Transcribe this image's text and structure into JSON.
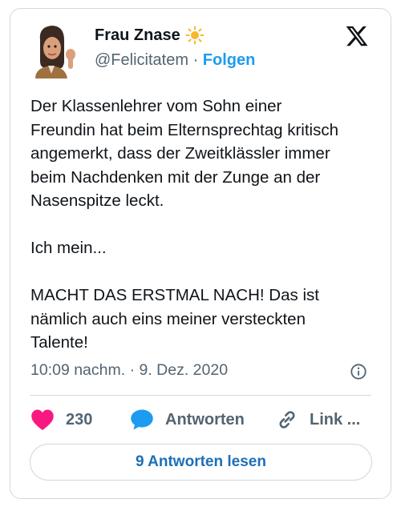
{
  "author": {
    "name": "Frau Znase",
    "name_emoji_icon": "sun-icon",
    "handle": "@Felicitatem",
    "separator": "·",
    "follow_label": "Folgen"
  },
  "platform_logo": "x-logo-icon",
  "tweet": {
    "paragraph1_lines": [
      "Der Klassenlehrer vom Sohn einer",
      "Freundin hat beim Elternsprechtag kritisch",
      "angemerkt, dass der Zweitklässler immer",
      "beim Nachdenken mit der Zunge an der",
      "Nasenspitze leckt."
    ],
    "paragraph2": "Ich mein...",
    "paragraph3_lines": [
      "MACHT DAS ERSTMAL NACH! Das ist",
      "nämlich auch eins meiner versteckten",
      "Talente!"
    ]
  },
  "timestamp": "10:09 nachm. · 9. Dez. 2020",
  "actions": {
    "likes_count": "230",
    "reply_label": "Antworten",
    "link_label": "Link ..."
  },
  "read_replies_label": "9 Antworten lesen",
  "colors": {
    "like": "#f91880",
    "reply": "#1d9bf0",
    "follow": "#1d9bf0",
    "border": "#cfd9de",
    "muted": "#536471"
  }
}
